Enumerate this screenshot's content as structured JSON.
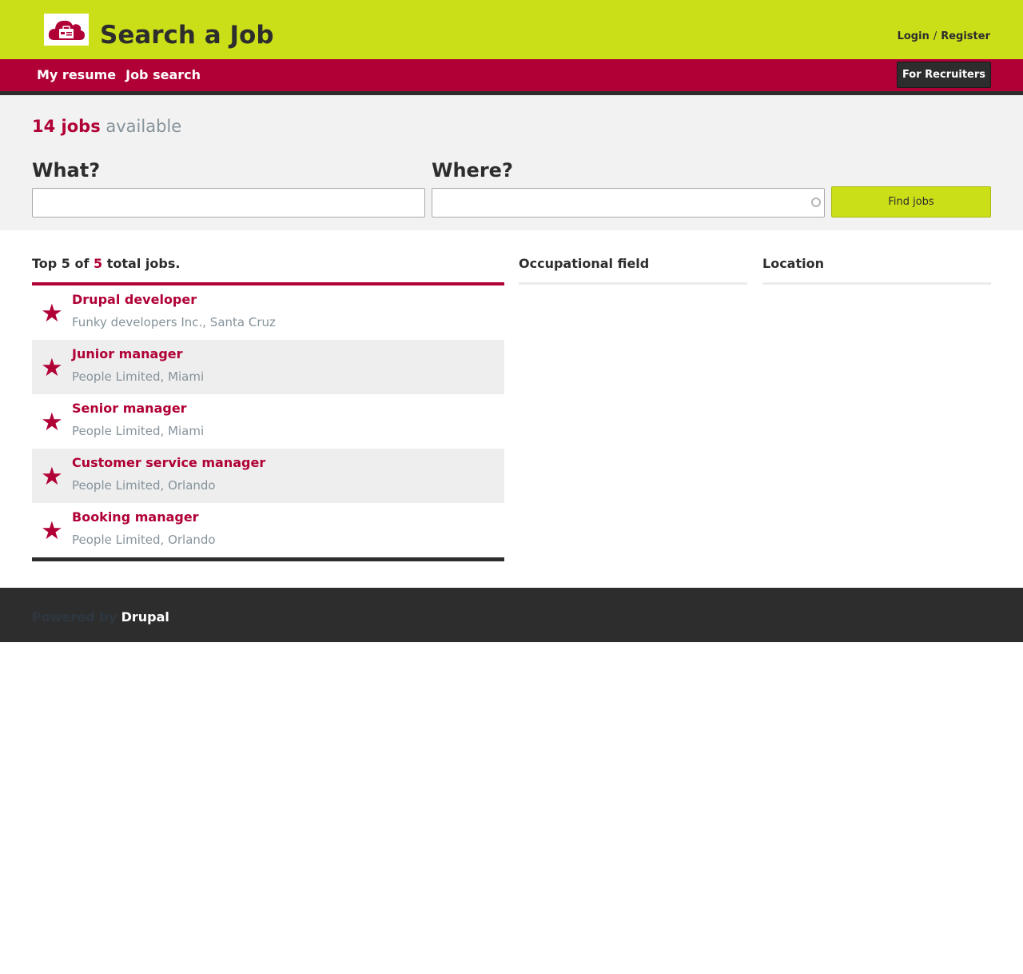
{
  "header": {
    "site_title": "Search a Job",
    "logo_icon": "cloud-briefcase-icon",
    "login_label": "Login",
    "login_sep": "/",
    "register_label": "Register",
    "brand_color": "#cbdf19"
  },
  "nav": {
    "items": [
      {
        "label": "My resume"
      },
      {
        "label": "Job search"
      }
    ],
    "recruiters_label": "For Recruiters",
    "bar_color": "#b00035"
  },
  "search": {
    "jobs_count": "14 jobs",
    "available": "available",
    "what_label": "What?",
    "where_label": "Where?",
    "what_value": "",
    "where_value": "",
    "button_label": "Find jobs"
  },
  "results": {
    "heading_pre": "Top 5 of",
    "heading_count": "5",
    "heading_post": "total jobs.",
    "jobs": [
      {
        "title": "Drupal developer",
        "meta": "Funky developers Inc., Santa Cruz",
        "icon": "star-icon"
      },
      {
        "title": "Junior manager",
        "meta": "People Limited, Miami",
        "icon": "star-icon"
      },
      {
        "title": "Senior manager",
        "meta": "People Limited, Miami",
        "icon": "star-icon"
      },
      {
        "title": "Customer service manager",
        "meta": "People Limited, Orlando",
        "icon": "star-icon"
      },
      {
        "title": "Booking manager",
        "meta": "People Limited, Orlando",
        "icon": "star-icon"
      }
    ]
  },
  "facets": {
    "occupational_field": "Occupational field",
    "location": "Location"
  },
  "footer": {
    "powered_by": "Powered by",
    "brand": "Drupal"
  }
}
